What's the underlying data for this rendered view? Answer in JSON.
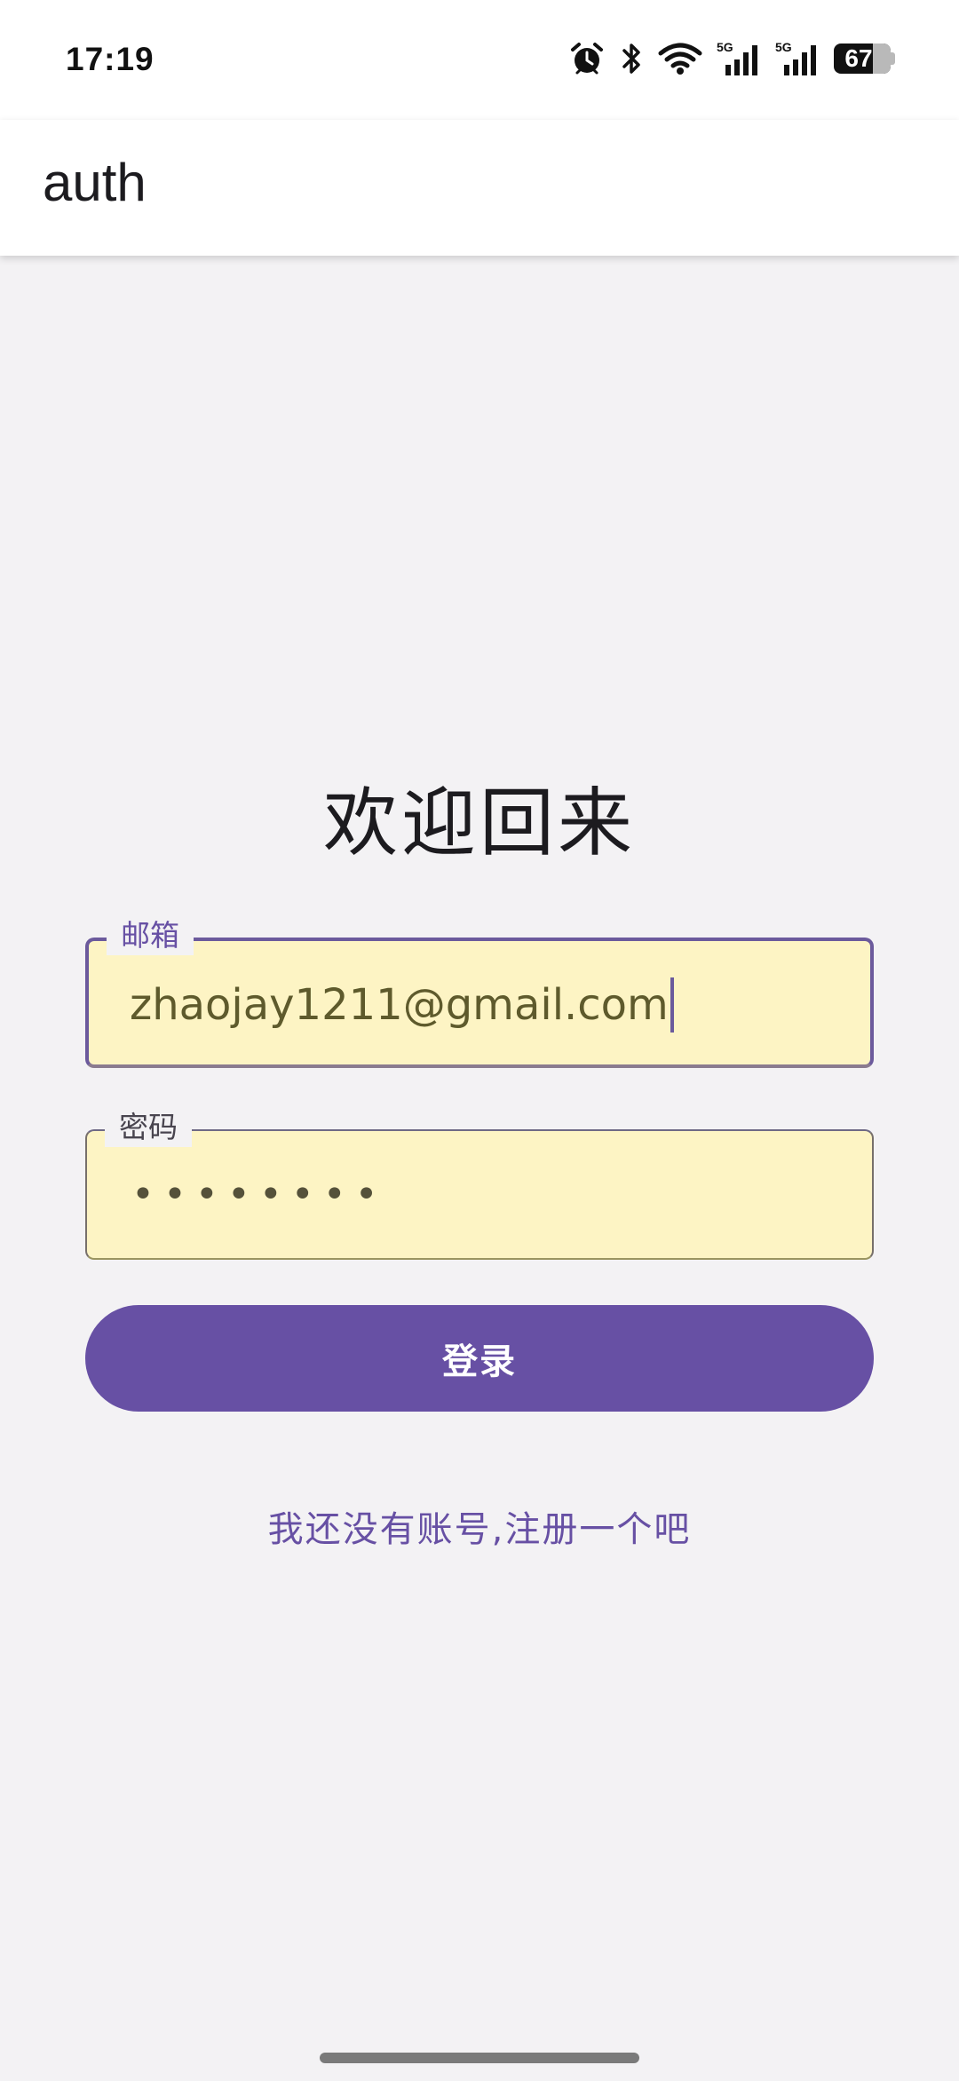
{
  "status_bar": {
    "time": "17:19",
    "battery": "67",
    "icons": [
      "alarm-icon",
      "bluetooth-icon",
      "wifi-icon",
      "signal-5g-icon",
      "signal-5g-icon",
      "battery-icon"
    ],
    "network_label_1": "5G",
    "network_label_2": "5G"
  },
  "app_bar": {
    "title": "auth"
  },
  "login": {
    "heading": "欢迎回来",
    "email_label": "邮箱",
    "email_value": "zhaojay1211@gmail.com",
    "password_label": "密码",
    "password_value": "••••••••",
    "login_button": "登录",
    "register_link": "我还没有账号,注册一个吧"
  },
  "colors": {
    "primary": "#6750a4",
    "field_fill": "#fdf4c4",
    "background": "#f3f2f4"
  }
}
